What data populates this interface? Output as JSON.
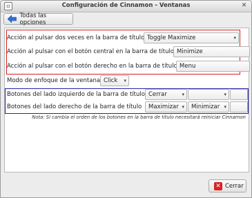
{
  "window": {
    "title": "Configuración de Cinnamon - Ventanas",
    "menu_icon": "window-menu-icon",
    "close_icon": "close-icon"
  },
  "toolbar": {
    "back_label": "Todas las opciones",
    "back_icon": "back-arrow-icon"
  },
  "title_bar_actions": [
    {
      "label": "Acción al pulsar dos veces en la barra de título",
      "value": "Toggle Maximize"
    },
    {
      "label": "Acción al pulsar con el botón central en la barra de título",
      "value": "Minimize"
    },
    {
      "label": "Acción al pulsar con el botón derecho en la barra de título",
      "value": "Menu"
    }
  ],
  "focus_mode": {
    "label": "Modo de enfoque de la ventana",
    "value": "Click"
  },
  "button_layout": {
    "left": {
      "label": "Botones del lado izquierdo de la barra de título",
      "values": [
        "Cerrar",
        ""
      ]
    },
    "right": {
      "label": "Botones del lado derecho de la barra de título",
      "values": [
        "Maximizar",
        "Minimizar"
      ]
    }
  },
  "note": "Nota: Si cambia el orden de los botones en la barra de título necesitará reiniciar Cinnamon",
  "footer": {
    "close_label": "Cerrar"
  },
  "colors": {
    "frame_red": "#d61d1d",
    "frame_blue": "#2323a8",
    "back_arrow": "#2f6fd6",
    "close_icon": "#d52525"
  }
}
